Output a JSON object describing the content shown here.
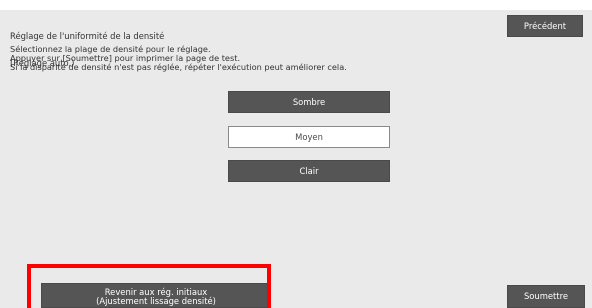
{
  "screen": {
    "title_lines": [
      "Réglage de l'uniformité de la densité",
      "(Réglage auto.)"
    ],
    "instructions": [
      "Sélectionnez la plage de densité pour le réglage.",
      "Appuyer sur [Soumettre] pour imprimer la page de test.",
      "Si la disparité de densité n'est pas réglée, répéter l'exécution peut améliorer cela."
    ]
  },
  "buttons": {
    "back": "Précédent",
    "submit": "Soumettre",
    "revert_line1": "Revenir aux rég. initiaux",
    "revert_line2": "(Ajustement lissage densité)"
  },
  "density_options": {
    "items": [
      "Sombre",
      "Moyen",
      "Clair"
    ],
    "selected": "Moyen"
  },
  "colors": {
    "background": "#eaeaea",
    "button": "#555555",
    "selected_button": "#ffffff",
    "highlight": "#ff0000"
  }
}
